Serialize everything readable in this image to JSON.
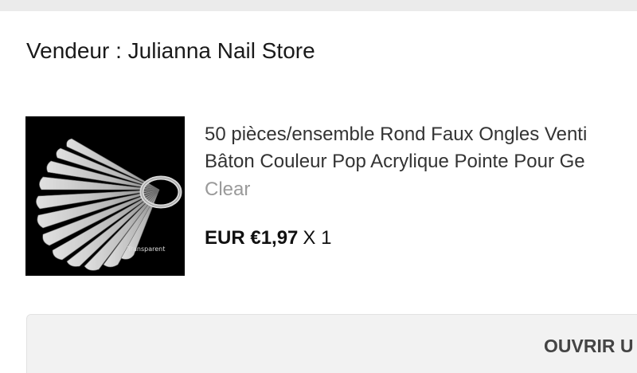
{
  "seller": {
    "label": "Vendeur : Julianna Nail Store"
  },
  "product": {
    "image_icon": "nail-tips-fan-image",
    "image_caption": "Transparent",
    "title_line1": "50 pièces/ensemble Rond Faux Ongles Venti",
    "title_line2": "Bâton Couleur Pop Acrylique Pointe Pour Ge",
    "variant": "Clear",
    "price": "EUR €1,97",
    "quantity": "X 1"
  },
  "actions": {
    "open_label": "OUVRIR U"
  }
}
